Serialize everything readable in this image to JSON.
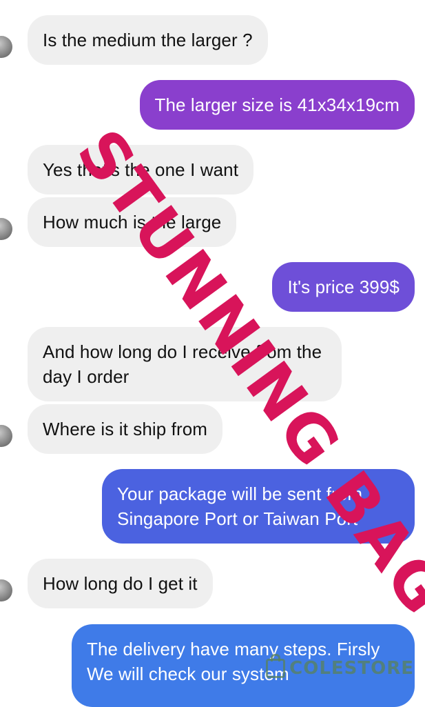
{
  "messages": [
    {
      "side": "in",
      "text": "Is the medium the larger ?"
    },
    {
      "side": "out",
      "text": "The larger size is 41x34x19cm",
      "color": "#8a3fcd"
    },
    {
      "side": "in",
      "text": "Yes that's the one I want"
    },
    {
      "side": "in",
      "text": "How much is the large"
    },
    {
      "side": "out",
      "text": "It's price 399$",
      "color": "#6e4fd8"
    },
    {
      "side": "in",
      "text": "And how long do I receive from the day I order"
    },
    {
      "side": "in",
      "text": "Where is it ship from"
    },
    {
      "side": "out",
      "text": "Your package will be sent from Singapore Port or Taiwan Port",
      "color": "#4b62e0"
    },
    {
      "side": "in",
      "text": "How long do I get it"
    },
    {
      "side": "out",
      "text": "The delivery have many steps. Firsly We will check our system",
      "color": "#3f7be8"
    }
  ],
  "overlay": {
    "stamp_text": "STUNNING BAG",
    "stamp_color": "#d8145a"
  },
  "watermark": {
    "text": "COLESTORE",
    "icon": "shopping-bag-icon"
  }
}
